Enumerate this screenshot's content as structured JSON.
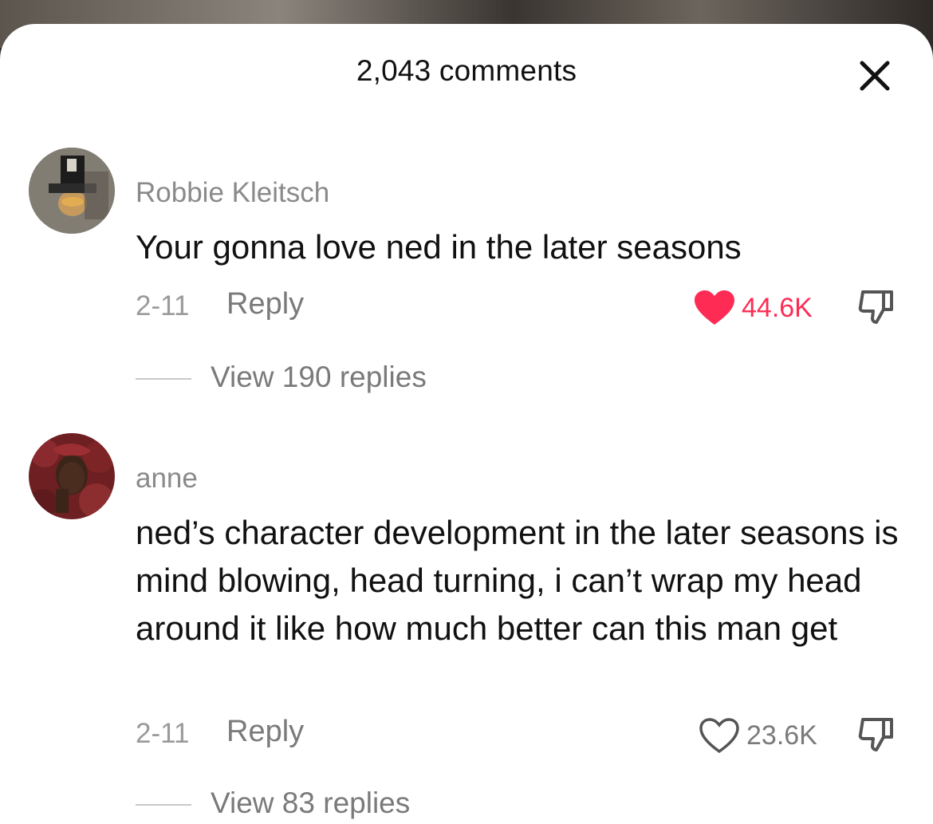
{
  "header": {
    "title": "2,043 comments",
    "close_icon": "close-icon"
  },
  "comments": [
    {
      "username": "Robbie Kleitsch",
      "text": "Your gonna love ned in the later seasons",
      "date": "2-11",
      "reply_label": "Reply",
      "likes": "44.6K",
      "liked": true,
      "like_color": "#fe2c55",
      "view_replies": "View 190 replies"
    },
    {
      "username": "anne",
      "text": "ned’s character development in the later seasons is mind blowing, head turning, i can’t wrap my head around it like how much better can this man get",
      "date": "2-11",
      "reply_label": "Reply",
      "likes": "23.6K",
      "liked": false,
      "view_replies": "View 83 replies"
    }
  ]
}
